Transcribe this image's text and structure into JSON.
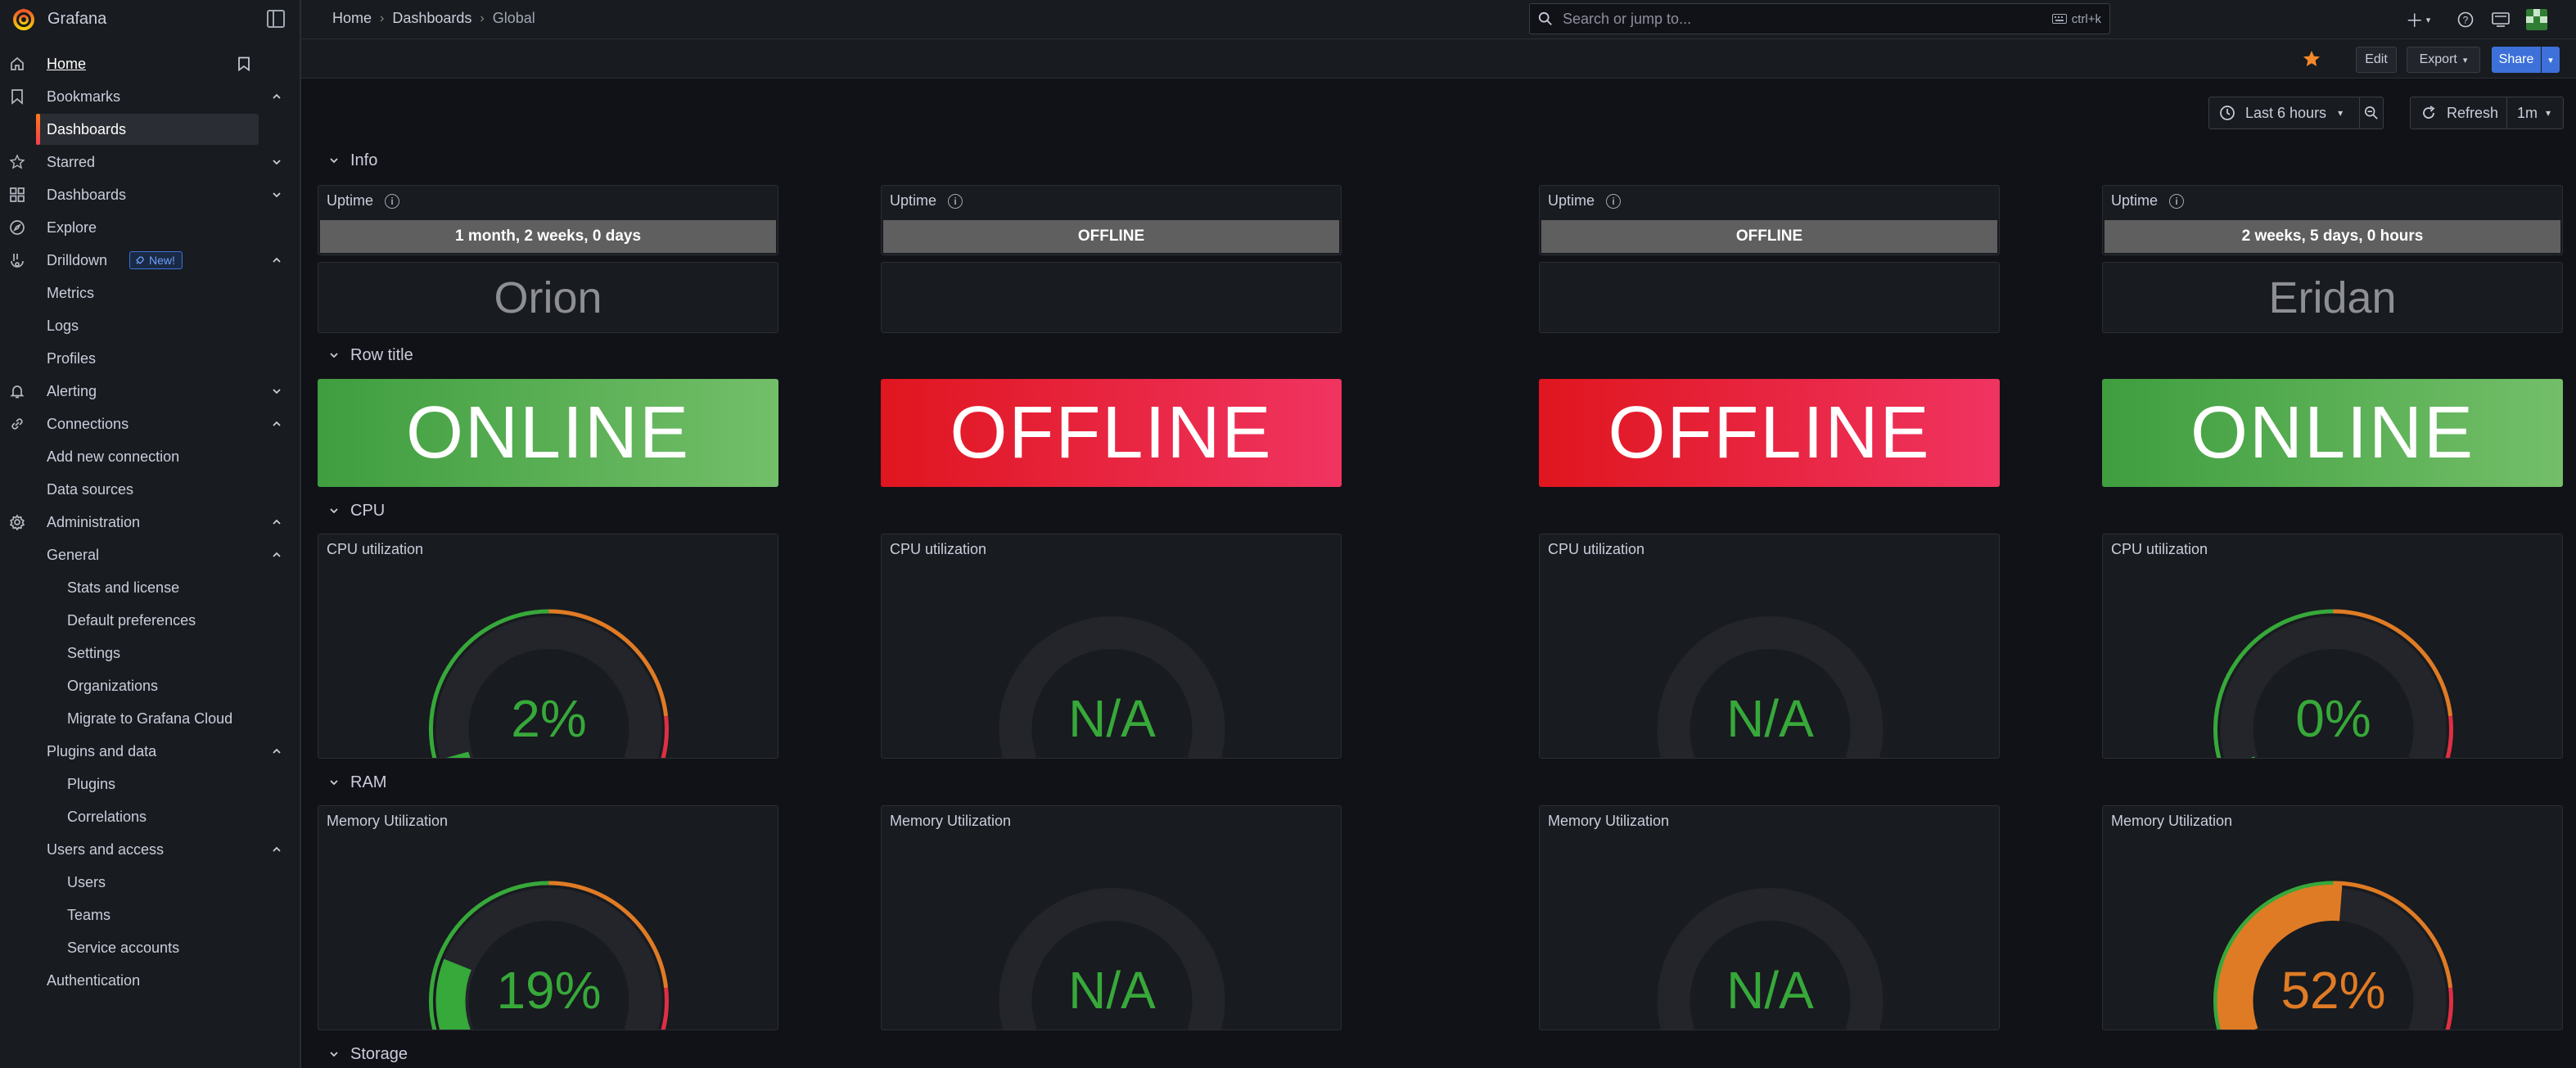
{
  "app": {
    "name": "Grafana"
  },
  "sidebar": {
    "items": [
      {
        "key": "home",
        "label": "Home",
        "level": 0,
        "icon": "home-icon"
      },
      {
        "key": "bookmarks",
        "label": "Bookmarks",
        "level": 0,
        "icon": "bookmark-icon",
        "expanded": true
      },
      {
        "key": "bm-dashboards",
        "label": "Dashboards",
        "level": 1,
        "selected": true
      },
      {
        "key": "starred",
        "label": "Starred",
        "level": 0,
        "icon": "star-icon",
        "expanded": false
      },
      {
        "key": "dashboards",
        "label": "Dashboards",
        "level": 0,
        "icon": "apps-icon",
        "expanded": false
      },
      {
        "key": "explore",
        "label": "Explore",
        "level": 0,
        "icon": "compass-icon"
      },
      {
        "key": "drilldown",
        "label": "Drilldown",
        "level": 0,
        "icon": "drilldown-icon",
        "expanded": true,
        "badge": "New!"
      },
      {
        "key": "metrics",
        "label": "Metrics",
        "level": 1
      },
      {
        "key": "logs",
        "label": "Logs",
        "level": 1
      },
      {
        "key": "profiles",
        "label": "Profiles",
        "level": 1
      },
      {
        "key": "alerting",
        "label": "Alerting",
        "level": 0,
        "icon": "bell-icon",
        "expanded": false
      },
      {
        "key": "connections",
        "label": "Connections",
        "level": 0,
        "icon": "link-icon",
        "expanded": true
      },
      {
        "key": "add-conn",
        "label": "Add new connection",
        "level": 1
      },
      {
        "key": "datasources",
        "label": "Data sources",
        "level": 1
      },
      {
        "key": "administration",
        "label": "Administration",
        "level": 0,
        "icon": "cog-icon",
        "expanded": true
      },
      {
        "key": "general",
        "label": "General",
        "level": 1,
        "expanded": true
      },
      {
        "key": "stats",
        "label": "Stats and license",
        "level": 2
      },
      {
        "key": "defprefs",
        "label": "Default preferences",
        "level": 2
      },
      {
        "key": "settings",
        "label": "Settings",
        "level": 2
      },
      {
        "key": "orgs",
        "label": "Organizations",
        "level": 2
      },
      {
        "key": "migrate",
        "label": "Migrate to Grafana Cloud",
        "level": 2
      },
      {
        "key": "plugins-data",
        "label": "Plugins and data",
        "level": 1,
        "expanded": true
      },
      {
        "key": "plugins",
        "label": "Plugins",
        "level": 2
      },
      {
        "key": "correlations",
        "label": "Correlations",
        "level": 2
      },
      {
        "key": "users-access",
        "label": "Users and access",
        "level": 1,
        "expanded": true
      },
      {
        "key": "users",
        "label": "Users",
        "level": 2
      },
      {
        "key": "teams",
        "label": "Teams",
        "level": 2
      },
      {
        "key": "svcacc",
        "label": "Service accounts",
        "level": 2
      },
      {
        "key": "auth",
        "label": "Authentication",
        "level": 1
      }
    ]
  },
  "breadcrumb": {
    "home": "Home",
    "dashboards": "Dashboards",
    "current": "Global"
  },
  "search": {
    "placeholder": "Search or jump to...",
    "shortcut": "ctrl+k"
  },
  "toolbar": {
    "edit": "Edit",
    "export": "Export",
    "share": "Share"
  },
  "time": {
    "range": "Last 6 hours",
    "refresh": "Refresh",
    "interval": "1m"
  },
  "rows": {
    "info": "Info",
    "row_title": "Row title",
    "cpu": "CPU",
    "ram": "RAM",
    "storage": "Storage"
  },
  "servers": [
    {
      "uptime_title": "Uptime",
      "uptime": "1 month, 2 weeks, 0 days",
      "name": "Orion",
      "status": "ONLINE",
      "cpu_title": "CPU utilization",
      "cpu": "2%",
      "cpu_value": 0.02,
      "mem_title": "Memory Utilization",
      "mem": "19%",
      "mem_value": 0.19
    },
    {
      "uptime_title": "Uptime",
      "uptime": "OFFLINE",
      "name": "",
      "status": "OFFLINE",
      "cpu_title": "CPU utilization",
      "cpu": "N/A",
      "cpu_value": null,
      "mem_title": "Memory Utilization",
      "mem": "N/A",
      "mem_value": null
    },
    {
      "uptime_title": "Uptime",
      "uptime": "OFFLINE",
      "name": "",
      "status": "OFFLINE",
      "cpu_title": "CPU utilization",
      "cpu": "N/A",
      "cpu_value": null,
      "mem_title": "Memory Utilization",
      "mem": "N/A",
      "mem_value": null
    },
    {
      "uptime_title": "Uptime",
      "uptime": "2 weeks, 5 days, 0 hours",
      "name": "Eridan",
      "status": "ONLINE",
      "cpu_title": "CPU utilization",
      "cpu": "0%",
      "cpu_value": 0.0,
      "mem_title": "Memory Utilization",
      "mem": "52%",
      "mem_value": 0.52
    }
  ],
  "colors": {
    "green": "#37a83a",
    "orange": "#e07b25",
    "red": "#e02f44",
    "track": "#23252b",
    "blue": "#3d71d9"
  }
}
